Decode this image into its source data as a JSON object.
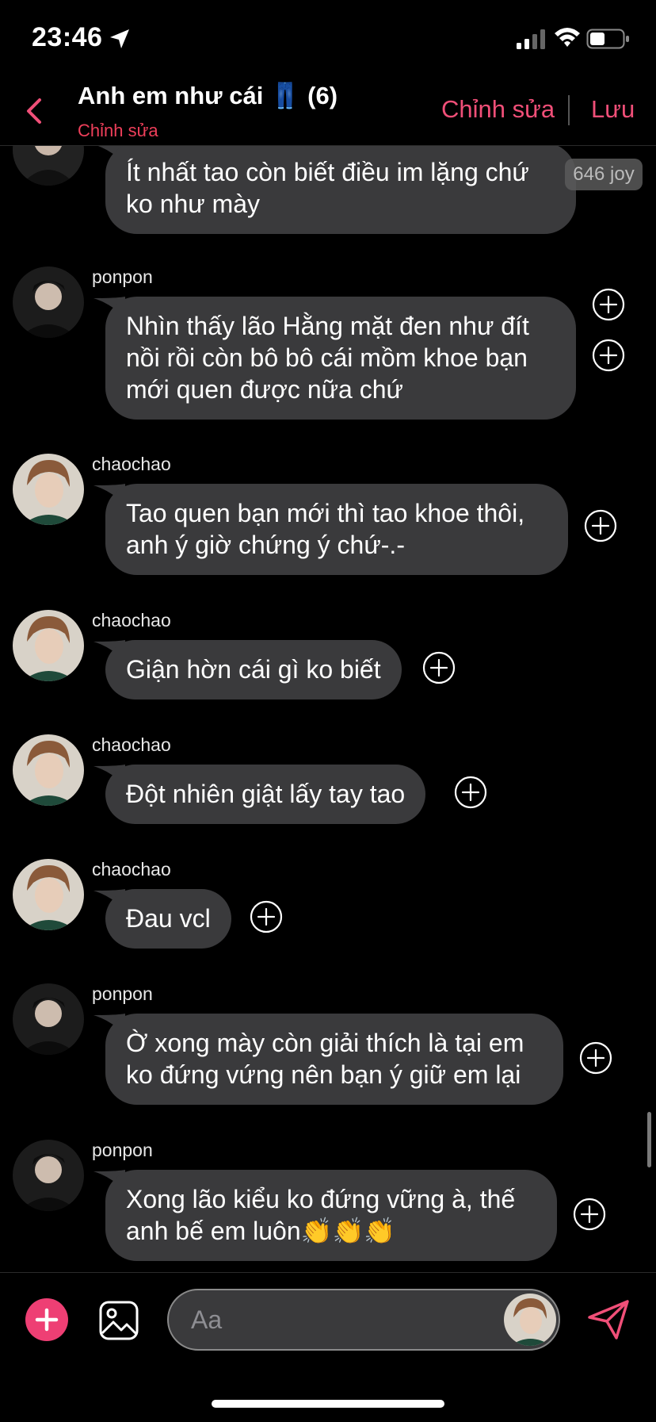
{
  "status_bar": {
    "time": "23:46"
  },
  "header": {
    "title": "Anh em như cái 👖 (6)",
    "subtitle": "Chỉnh sửa",
    "edit_label": "Chỉnh sửa",
    "save_label": "Lưu"
  },
  "colors": {
    "accent": "#f04f78",
    "bubble": "#3a3a3c",
    "background": "#000000"
  },
  "messages": [
    {
      "sender": "",
      "text": "Ít nhất tao còn biết điều im lặng chứ ko như mày",
      "badge": "646 joy"
    },
    {
      "sender": "ponpon",
      "text": "Nhìn thấy lão Hằng mặt đen như đít nồi rồi còn bô bô cái mồm khoe bạn mới quen được nữa chứ"
    },
    {
      "sender": "chaochao",
      "text": "Tao quen bạn mới thì tao khoe thôi, anh ý giờ chứng ý chứ-.-"
    },
    {
      "sender": "chaochao",
      "text": "Giận hờn cái gì ko biết"
    },
    {
      "sender": "chaochao",
      "text": "Đột nhiên giật lấy tay tao"
    },
    {
      "sender": "chaochao",
      "text": "Đau vcl"
    },
    {
      "sender": "ponpon",
      "text": "Ờ xong mày còn giải thích là tại em ko đứng vứng nên bạn ý giữ em lại"
    },
    {
      "sender": "ponpon",
      "text": "Xong lão kiểu ko đứng vững à, thế anh bế em luôn👏👏👏"
    }
  ],
  "composer": {
    "placeholder": "Aa"
  },
  "icons": {
    "back": "chevron-left-icon",
    "add": "plus-circle-icon",
    "image": "image-icon",
    "send": "send-icon",
    "react": "plus-circle-outline-icon"
  }
}
